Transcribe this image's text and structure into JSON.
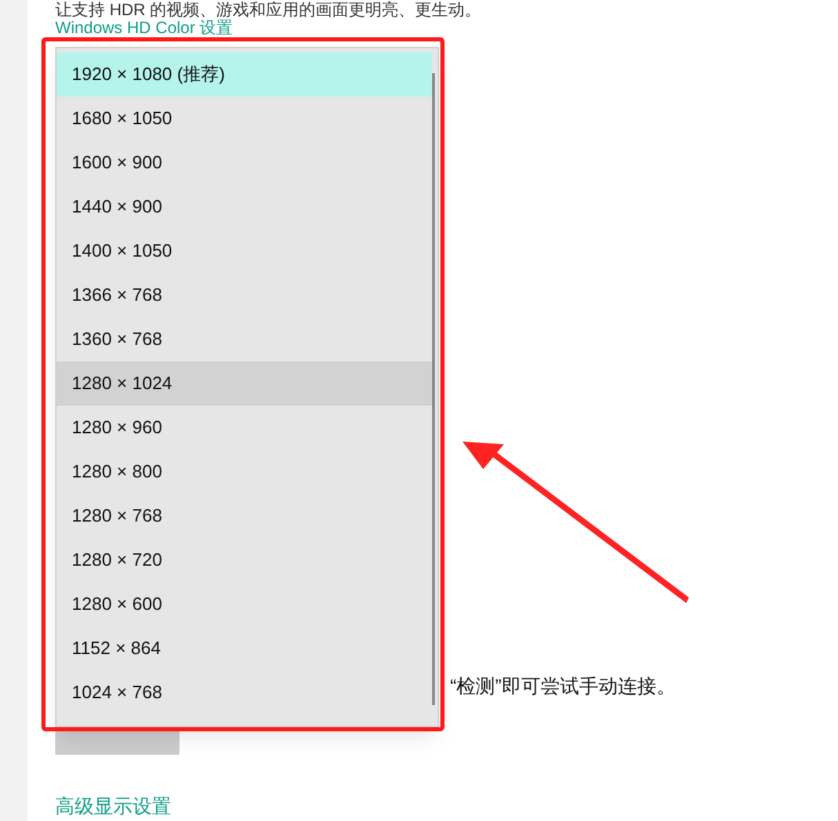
{
  "description": "让支持 HDR 的视频、游戏和应用的画面更明亮、更生动。",
  "hdr_link": "Windows HD Color 设置",
  "dropdown": {
    "options": [
      {
        "label": "1920 × 1080 (推荐)",
        "selected": true,
        "hovered": false
      },
      {
        "label": "1680 × 1050",
        "selected": false,
        "hovered": false
      },
      {
        "label": "1600 × 900",
        "selected": false,
        "hovered": false
      },
      {
        "label": "1440 × 900",
        "selected": false,
        "hovered": false
      },
      {
        "label": "1400 × 1050",
        "selected": false,
        "hovered": false
      },
      {
        "label": "1366 × 768",
        "selected": false,
        "hovered": false
      },
      {
        "label": "1360 × 768",
        "selected": false,
        "hovered": false
      },
      {
        "label": "1280 × 1024",
        "selected": false,
        "hovered": true
      },
      {
        "label": "1280 × 960",
        "selected": false,
        "hovered": false
      },
      {
        "label": "1280 × 800",
        "selected": false,
        "hovered": false
      },
      {
        "label": "1280 × 768",
        "selected": false,
        "hovered": false
      },
      {
        "label": "1280 × 720",
        "selected": false,
        "hovered": false
      },
      {
        "label": "1280 × 600",
        "selected": false,
        "hovered": false
      },
      {
        "label": "1152 × 864",
        "selected": false,
        "hovered": false
      },
      {
        "label": "1024 × 768",
        "selected": false,
        "hovered": false
      }
    ]
  },
  "detect_hint": "“检测”即可尝试手动连接。",
  "advanced_link": "高级显示设置"
}
